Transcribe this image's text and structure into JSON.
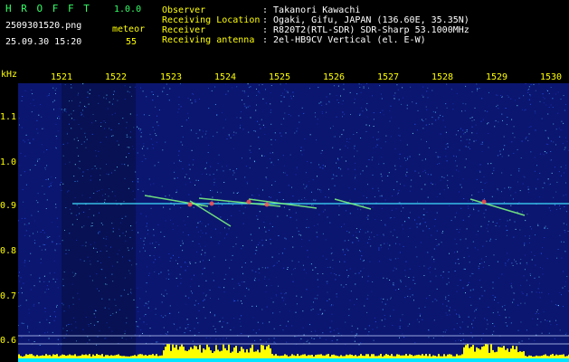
{
  "header": {
    "app_name": "H R O F F T",
    "version": "1.0.0",
    "filename": "2509301520.png",
    "datetime": "25.09.30 15:20",
    "meteor_label": "meteor",
    "meteor_count": "55"
  },
  "station": {
    "rows": [
      {
        "label": "Observer",
        "value": ": Takanori Kawachi"
      },
      {
        "label": "Receiving Location",
        "value": ": Ogaki, Gifu, JAPAN (136.60E, 35.35N)"
      },
      {
        "label": "Receiver",
        "value": ": R820T2(RTL-SDR) SDR-Sharp 53.1000MHz"
      },
      {
        "label": "Receiving antenna",
        "value": ": 2el-HB9CV Vertical (el. E-W)"
      }
    ]
  },
  "spectrogram": {
    "y_unit": "kHz",
    "x_ticks": [
      "1521",
      "1522",
      "1523",
      "1524",
      "1525",
      "1526",
      "1527",
      "1528",
      "1529",
      "1530"
    ],
    "y_ticks": [
      "1.1",
      "1.0",
      "0.9",
      "0.8",
      "0.7",
      "0.6"
    ],
    "colors": {
      "background": "#0b1670",
      "carrier": "#40e0ff",
      "echo": "#7fff7f",
      "hot": "#ff5050",
      "level_bar": "#ffff00",
      "baseline": "#00e5ff"
    }
  }
}
